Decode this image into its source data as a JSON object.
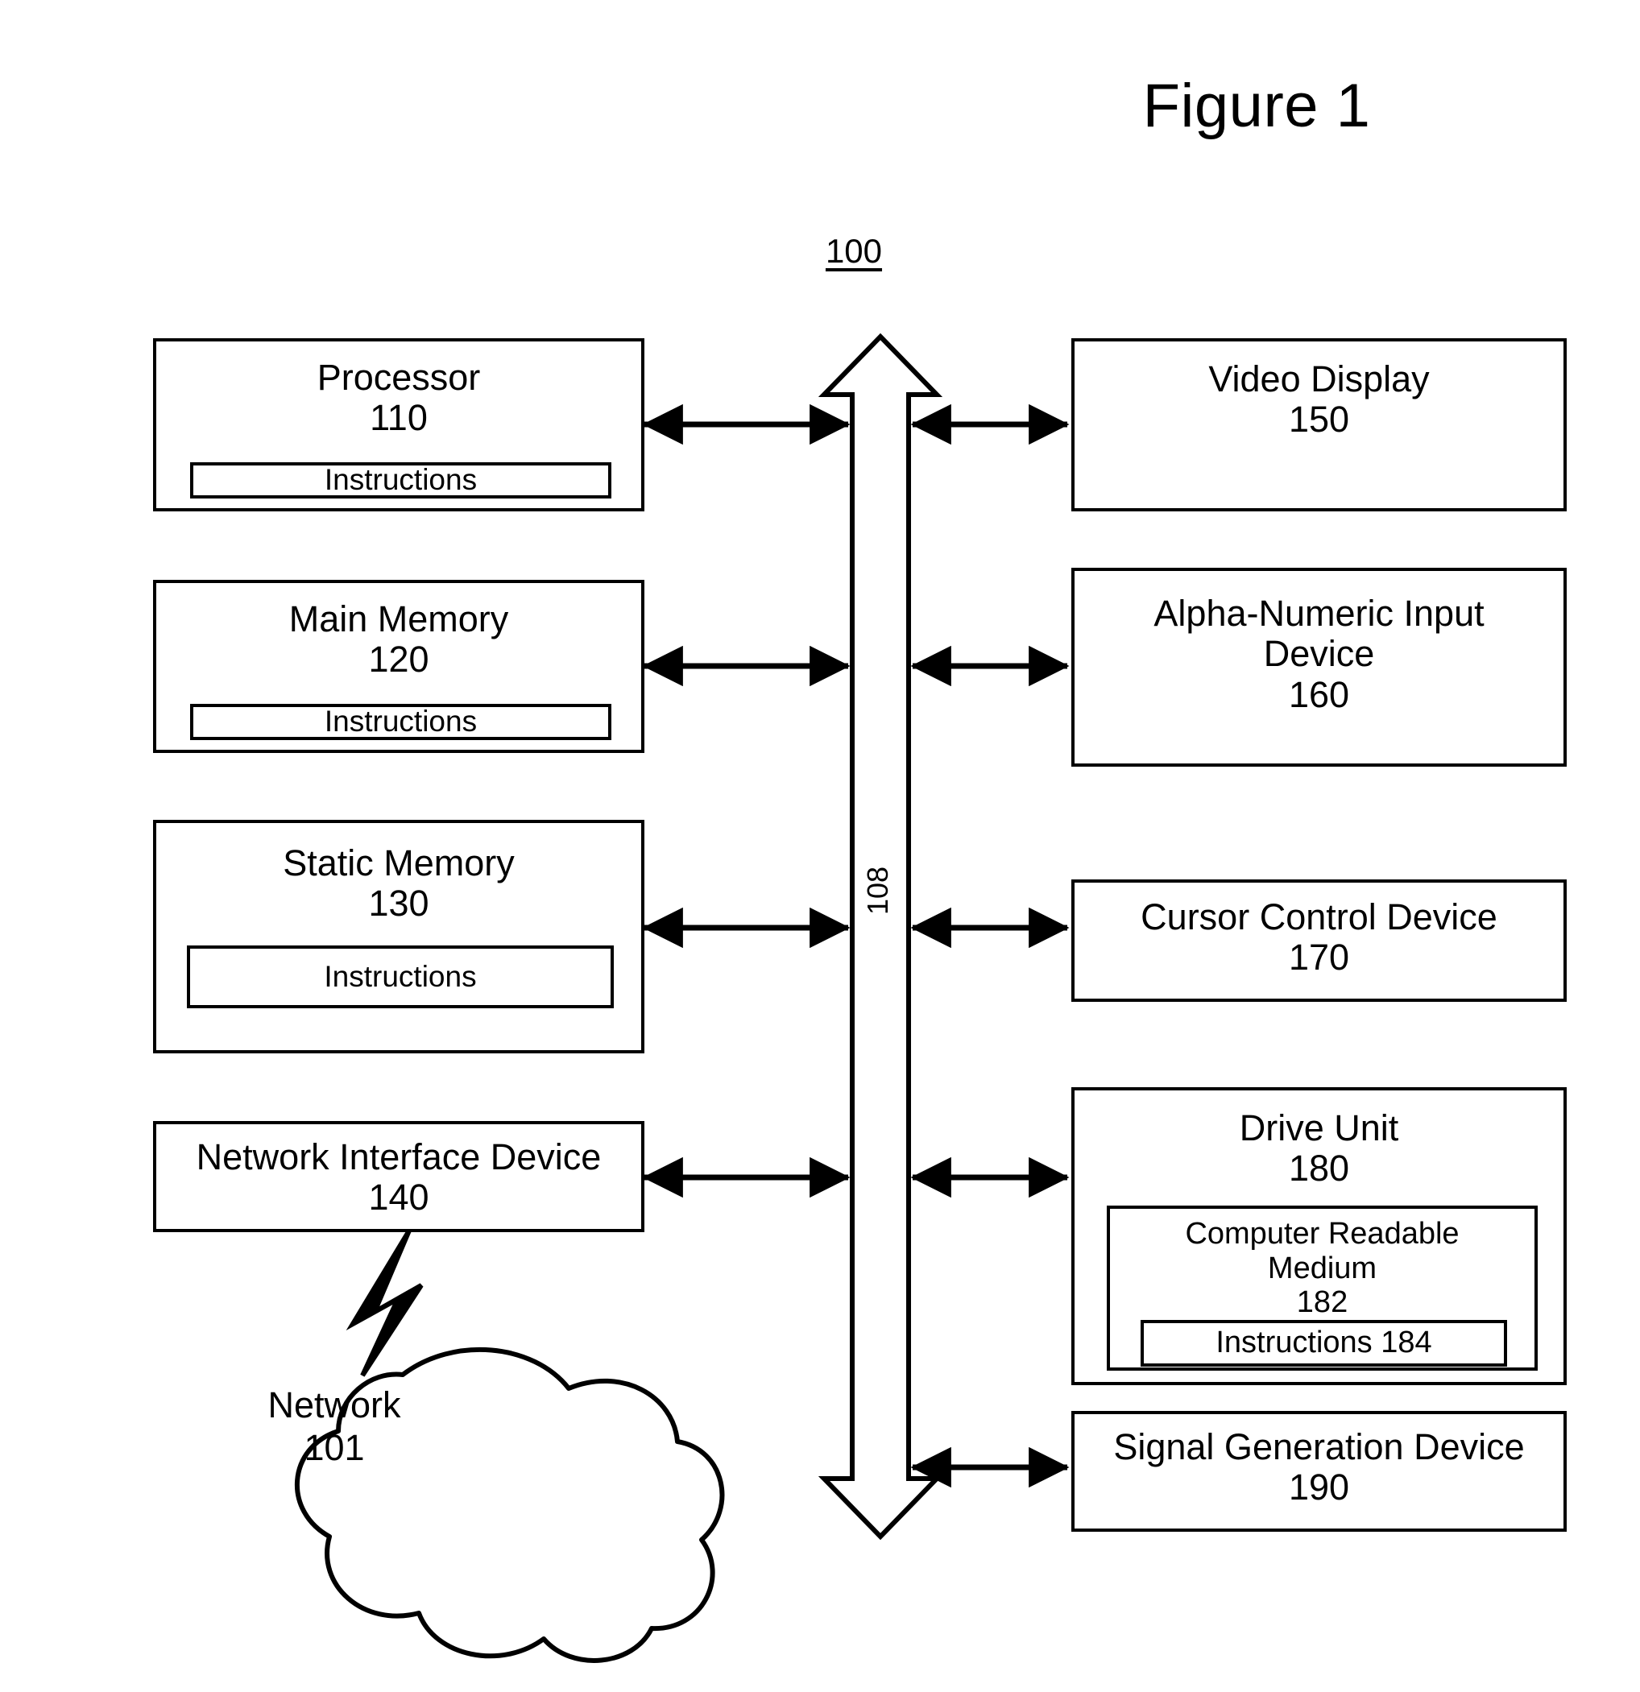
{
  "figure": {
    "title": "Figure 1",
    "system_ref": "100",
    "bus_ref": "108"
  },
  "left_column": [
    {
      "name": "Processor",
      "ref": "110",
      "inner": {
        "label": "Instructions"
      }
    },
    {
      "name": "Main Memory",
      "ref": "120",
      "inner": {
        "label": "Instructions"
      }
    },
    {
      "name": "Static Memory",
      "ref": "130",
      "inner": {
        "label": "Instructions"
      }
    },
    {
      "name": "Network Interface Device",
      "ref": "140",
      "inner": null
    }
  ],
  "right_column": [
    {
      "name": "Video Display",
      "ref": "150"
    },
    {
      "name": "Alpha-Numeric Input\nDevice",
      "ref": "160"
    },
    {
      "name": "Cursor Control Device",
      "ref": "170"
    },
    {
      "name": "Drive Unit",
      "ref": "180",
      "inner": {
        "name": "Computer Readable\nMedium",
        "ref": "182",
        "inner": {
          "label": "Instructions 184"
        }
      }
    },
    {
      "name": "Signal Generation Device",
      "ref": "190"
    }
  ],
  "network": {
    "name": "Network",
    "ref": "101"
  },
  "colors": {
    "ink": "#000000",
    "paper": "#ffffff"
  }
}
